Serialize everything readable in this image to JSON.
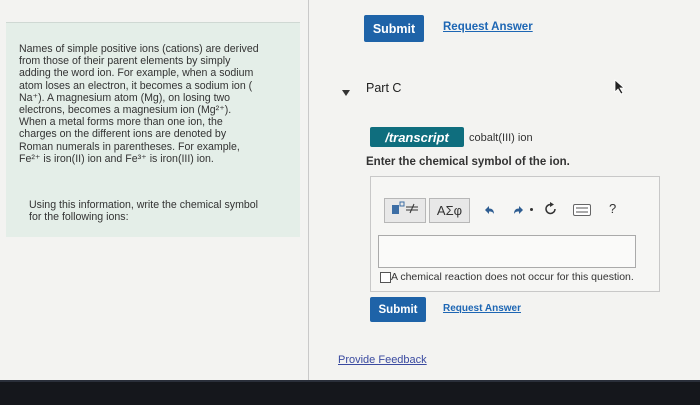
{
  "top_actions": {
    "submit_label": "Submit",
    "request_label": "Request Answer"
  },
  "info_panel": {
    "paragraph1_lines": [
      "Names of simple positive ions (cations) are derived",
      "from those of their parent elements by simply",
      "adding the word ion. For example, when a sodium",
      "atom loses an electron, it becomes a sodium ion (",
      "Na⁺). A magnesium atom (Mg), on losing two",
      "electrons, becomes a magnesium ion (Mg²⁺).",
      "When a metal forms more than one ion, the",
      "charges on the different ions are denoted by",
      "Roman numerals in parentheses. For example,",
      "Fe²⁺ is iron(II) ion and Fe³⁺ is iron(III) ion."
    ],
    "paragraph2_lines": [
      "Using this information, write the chemical symbol",
      "for the following ions:"
    ]
  },
  "part": {
    "label": "Part C"
  },
  "transcript": {
    "badge": "/transcript",
    "text": "cobalt(III) ion"
  },
  "prompt": "Enter the chemical symbol of the ion.",
  "toolbar": {
    "symbols_label": "ΑΣφ",
    "help_label": "?"
  },
  "answer": {
    "value": ""
  },
  "no_reaction_label": "A chemical reaction does not occur for this question.",
  "bottom_actions": {
    "submit_label": "Submit",
    "request_label": "Request Answer"
  },
  "feedback_label": "Provide Feedback"
}
